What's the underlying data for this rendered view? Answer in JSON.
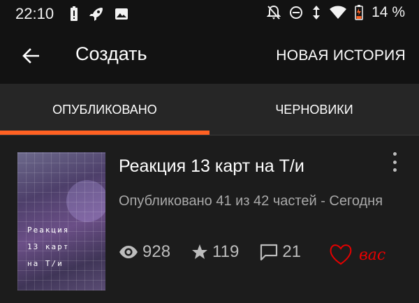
{
  "status_bar": {
    "time": "22:10",
    "battery": "14 %",
    "left_icons": [
      "battery-alert-icon",
      "rocket-icon",
      "image-icon"
    ],
    "right_icons": [
      "notifications-off-icon",
      "do-not-disturb-icon",
      "data-arrows-icon",
      "wifi-icon",
      "battery-icon"
    ]
  },
  "app_bar": {
    "back_icon": "arrow-back-icon",
    "title": "Создать",
    "action": "НОВАЯ ИСТОРИЯ"
  },
  "tabs": [
    {
      "label": "ОПУБЛИКОВАНО",
      "selected": true
    },
    {
      "label": "ЧЕРНОВИКИ",
      "selected": false
    }
  ],
  "colors": {
    "accent": "#ff6122",
    "background": "#1c1c1c",
    "bar": "#121212",
    "tabs": "#262626",
    "annotation": "#e60000"
  },
  "story": {
    "title": "Реакция 13 карт на Т/и",
    "cover_text": "Реакция\n13 карт\nна Т/и",
    "meta": "Опубликовано 41 из 42 частей - Сегодня",
    "views": "928",
    "votes": "119",
    "comments": "21",
    "more_icon": "more-vertical-icon"
  },
  "annotation": {
    "text": "вас"
  }
}
